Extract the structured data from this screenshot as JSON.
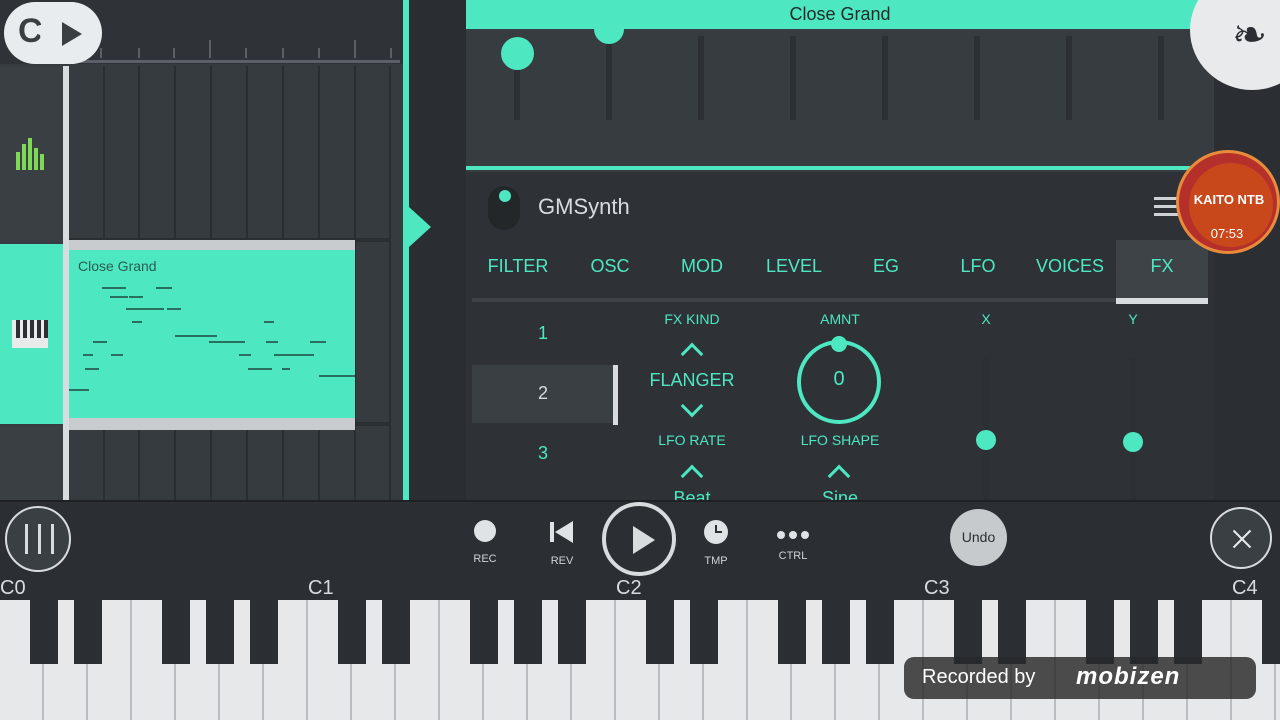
{
  "header": {
    "channel_title": "Close Grand"
  },
  "playlist": {
    "clip_title": "Close Grand"
  },
  "synth": {
    "name": "GMSynth",
    "tabs": [
      "FILTER",
      "OSC",
      "MOD",
      "LEVEL",
      "EG",
      "LFO",
      "VOICES",
      "FX"
    ],
    "active_tab": "FX",
    "presets": [
      "1",
      "2",
      "3"
    ],
    "active_preset": "2",
    "fx": {
      "fx_kind_label": "FX KIND",
      "fx_kind_value": "FLANGER",
      "amnt_label": "AMNT",
      "amnt_value": "0",
      "x_label": "X",
      "y_label": "Y",
      "lfo_rate_label": "LFO RATE",
      "lfo_rate_value": "Beat",
      "lfo_shape_label": "LFO SHAPE",
      "lfo_shape_value": "Sine"
    }
  },
  "transport": {
    "rec_label": "REC",
    "rev_label": "REV",
    "tmp_label": "TMP",
    "ctrl_label": "CTRL",
    "undo_label": "Undo"
  },
  "keyboard": {
    "octave_labels": [
      "C0",
      "C1",
      "C2",
      "C3",
      "C4"
    ]
  },
  "overlay": {
    "avatar_name": "KAITO NTB",
    "avatar_sub": "07:53",
    "recorded_by": "Recorded by",
    "recorder_brand": "mobizen"
  },
  "colors": {
    "accent": "#4de8c2",
    "background": "#2b2f33",
    "panel": "#373c40"
  },
  "icons": {
    "mode_toggle": "c-play-toggle-icon",
    "mixer": "mixer-sliders-icon",
    "close": "close-x-icon",
    "logo": "fruit-logo-icon",
    "menu": "hamburger-menu-icon"
  }
}
